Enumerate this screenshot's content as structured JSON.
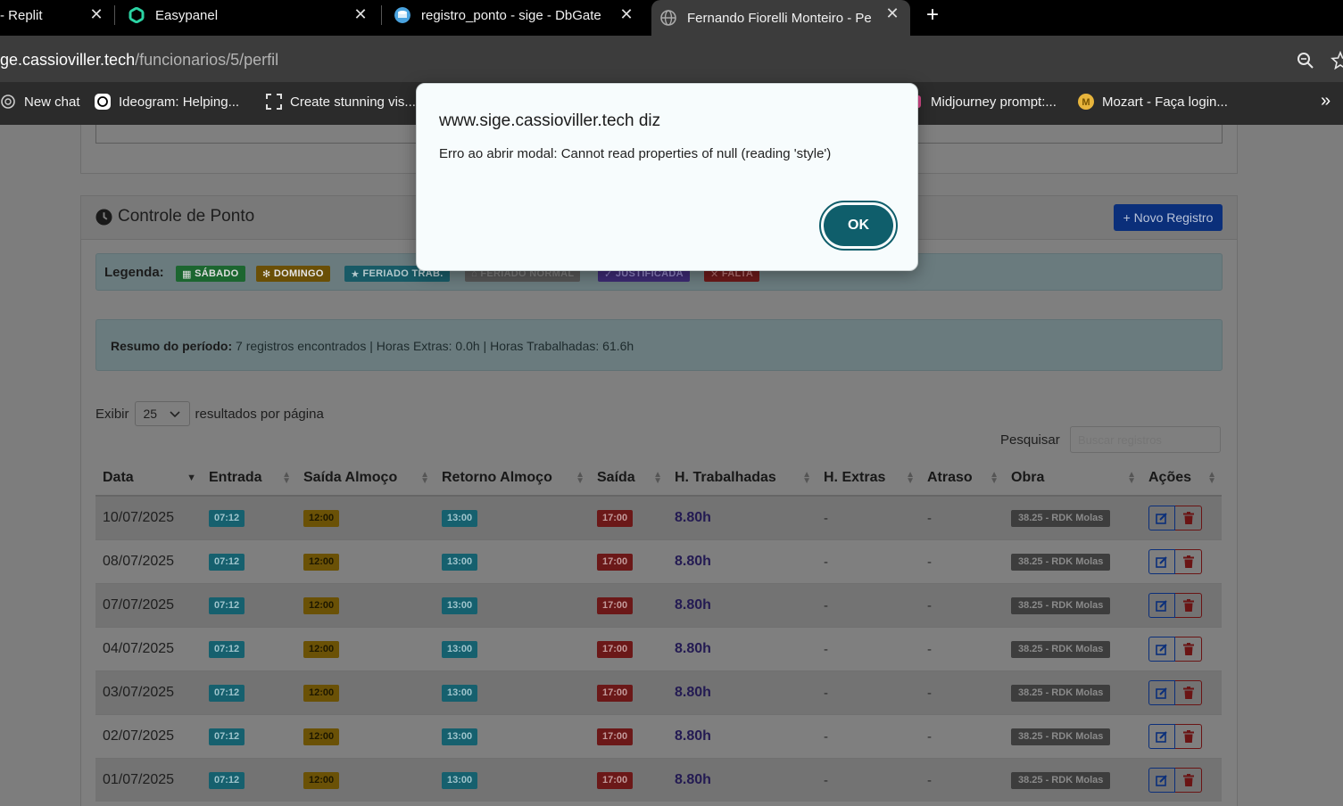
{
  "browser": {
    "tabs": [
      {
        "title": "- Replit",
        "active": false
      },
      {
        "title": "Easypanel",
        "active": false
      },
      {
        "title": "registro_ponto - sige - DbGate",
        "active": false
      },
      {
        "title": "Fernando Fiorelli Monteiro - Pe",
        "active": true
      }
    ],
    "close_glyph": "✕",
    "new_tab_glyph": "+",
    "url_host": "ge.cassioviller.tech",
    "url_path": "/funcionarios/5/perfil",
    "bookmarks": [
      {
        "label": "New chat",
        "icon": "openai-icon"
      },
      {
        "label": "Ideogram: Helping...",
        "icon": "ideogram-icon"
      },
      {
        "label": "Create stunning vis...",
        "icon": "frame-icon"
      },
      {
        "label": "Midjourney prompt:...",
        "icon": "midjourney-icon"
      },
      {
        "label": "Mozart - Faça login...",
        "icon": "mozart-icon"
      }
    ],
    "more_glyph": "»"
  },
  "ponto": {
    "title": "Controle de Ponto",
    "new_button": "+ Novo Registro",
    "legend_label": "Legenda:",
    "legend": [
      {
        "label": "SÁBADO",
        "icon": "calendar-icon",
        "color": "#1c6630"
      },
      {
        "label": "DOMINGO",
        "icon": "gear-icon",
        "color": "#6a4f06"
      },
      {
        "label": "FERIADO TRAB.",
        "icon": "star-icon",
        "color": "#185a66"
      },
      {
        "label": "FERIADO NORMAL",
        "icon": "home-icon",
        "color": "#555555"
      },
      {
        "label": "JUSTIFICADA",
        "icon": "check-icon",
        "color": "#3c2a72"
      },
      {
        "label": "FALTA",
        "icon": "x-icon",
        "color": "#6b1a1a"
      }
    ],
    "summary_label": "Resumo do período:",
    "summary_text": " 7 registros encontrados | Horas Extras: 0.0h | Horas Trabalhadas: 61.6h",
    "length_prefix": "Exibir",
    "length_value": "25",
    "length_suffix": "resultados por página",
    "search_label": "Pesquisar",
    "search_placeholder": "Buscar registros",
    "columns": [
      "Data",
      "Entrada",
      "Saída Almoço",
      "Retorno Almoço",
      "Saída",
      "H. Trabalhadas",
      "H. Extras",
      "Atraso",
      "Obra",
      "Ações"
    ],
    "rows": [
      {
        "data": "10/07/2025",
        "entrada": "07:12",
        "saida_almoco": "12:00",
        "retorno": "13:00",
        "saida": "17:00",
        "horas": "8.80h",
        "extras": "-",
        "atraso": "-",
        "obra": "38.25 - RDK Molas"
      },
      {
        "data": "08/07/2025",
        "entrada": "07:12",
        "saida_almoco": "12:00",
        "retorno": "13:00",
        "saida": "17:00",
        "horas": "8.80h",
        "extras": "-",
        "atraso": "-",
        "obra": "38.25 - RDK Molas"
      },
      {
        "data": "07/07/2025",
        "entrada": "07:12",
        "saida_almoco": "12:00",
        "retorno": "13:00",
        "saida": "17:00",
        "horas": "8.80h",
        "extras": "-",
        "atraso": "-",
        "obra": "38.25 - RDK Molas"
      },
      {
        "data": "04/07/2025",
        "entrada": "07:12",
        "saida_almoco": "12:00",
        "retorno": "13:00",
        "saida": "17:00",
        "horas": "8.80h",
        "extras": "-",
        "atraso": "-",
        "obra": "38.25 - RDK Molas"
      },
      {
        "data": "03/07/2025",
        "entrada": "07:12",
        "saida_almoco": "12:00",
        "retorno": "13:00",
        "saida": "17:00",
        "horas": "8.80h",
        "extras": "-",
        "atraso": "-",
        "obra": "38.25 - RDK Molas"
      },
      {
        "data": "02/07/2025",
        "entrada": "07:12",
        "saida_almoco": "12:00",
        "retorno": "13:00",
        "saida": "17:00",
        "horas": "8.80h",
        "extras": "-",
        "atraso": "-",
        "obra": "38.25 - RDK Molas"
      },
      {
        "data": "01/07/2025",
        "entrada": "07:12",
        "saida_almoco": "12:00",
        "retorno": "13:00",
        "saida": "17:00",
        "horas": "8.80h",
        "extras": "-",
        "atraso": "-",
        "obra": "38.25 - RDK Molas"
      }
    ],
    "colors": {
      "entrada": "#16606e",
      "saida_almoco": "#6a5106",
      "retorno": "#16606e",
      "saida": "#6b1818"
    }
  },
  "dialog": {
    "title": "www.sige.cassioviller.tech diz",
    "message": "Erro ao abrir modal: Cannot read properties of null (reading 'style')",
    "ok_label": "OK"
  }
}
